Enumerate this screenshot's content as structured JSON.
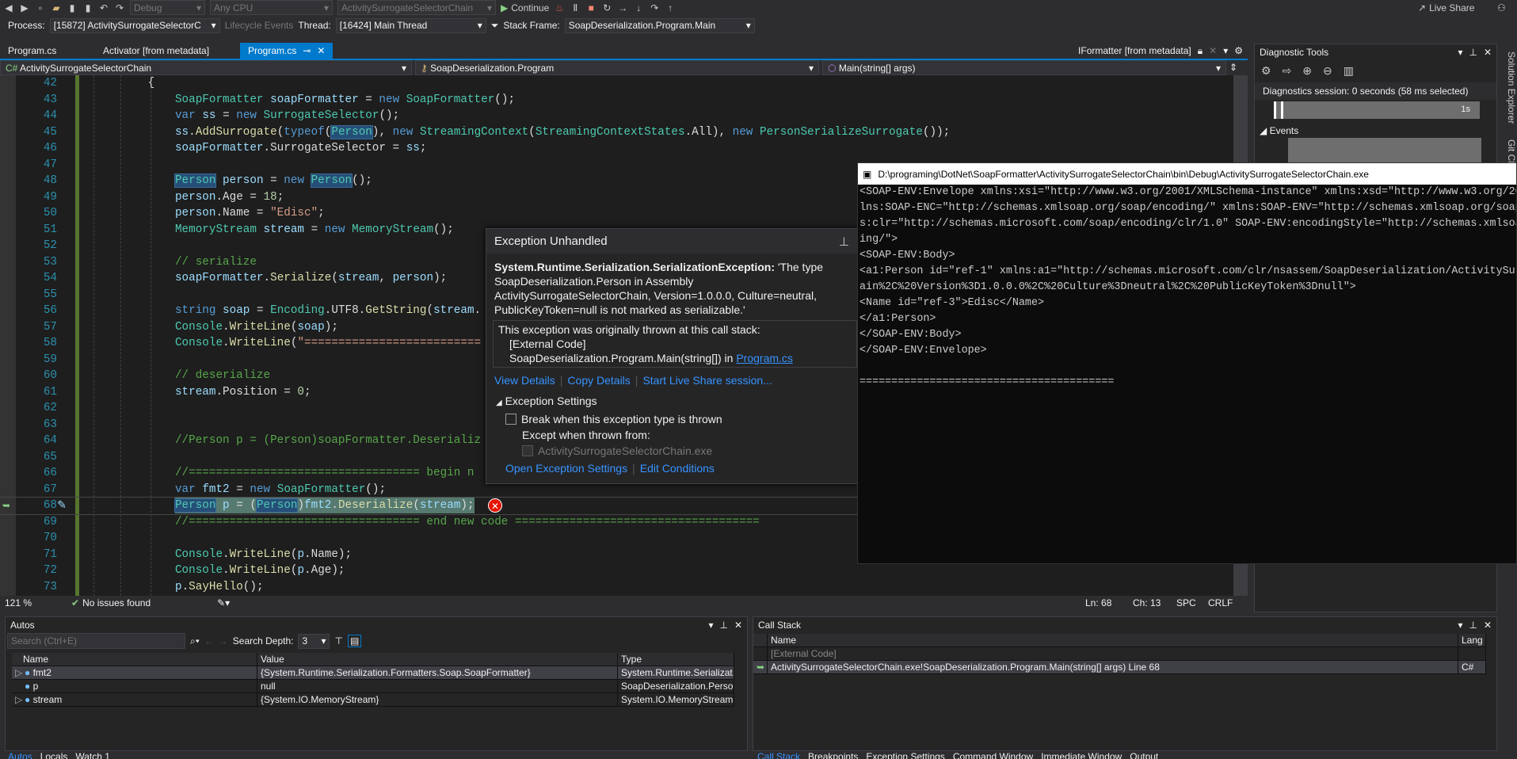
{
  "toolbar": {
    "config": "Debug",
    "platform": "Any CPU",
    "startup": "ActivitySurrogateSelectorChain",
    "continue": "Continue",
    "live_share": "Live Share"
  },
  "debug_location": {
    "process_label": "Process:",
    "process": "[15872] ActivitySurrogateSelectorC",
    "lifecycle": "Lifecycle Events",
    "thread_label": "Thread:",
    "thread": "[16424] Main Thread",
    "frame_label": "Stack Frame:",
    "frame": "SoapDeserialization.Program.Main"
  },
  "tabs": [
    {
      "label": "Program.cs"
    },
    {
      "label": "Activator [from metadata]"
    },
    {
      "label": "Program.cs",
      "active": true
    }
  ],
  "right_tab": "IFormatter [from metadata]",
  "navbar": {
    "project": "ActivitySurrogateSelectorChain",
    "type": "SoapDeserialization.Program",
    "member": "Main(string[] args)"
  },
  "code": {
    "first_line": 42,
    "current_line": 68,
    "lines": [
      [
        [
          "p",
          "        {"
        ]
      ],
      [
        [
          "p",
          "            "
        ],
        [
          "t",
          "SoapFormatter"
        ],
        [
          "p",
          " "
        ],
        [
          "v",
          "soapFormatter"
        ],
        [
          "p",
          " = "
        ],
        [
          "k",
          "new"
        ],
        [
          "p",
          " "
        ],
        [
          "t",
          "SoapFormatter"
        ],
        [
          "p",
          "();"
        ]
      ],
      [
        [
          "p",
          "            "
        ],
        [
          "k",
          "var"
        ],
        [
          "p",
          " "
        ],
        [
          "v",
          "ss"
        ],
        [
          "p",
          " = "
        ],
        [
          "k",
          "new"
        ],
        [
          "p",
          " "
        ],
        [
          "t",
          "SurrogateSelector"
        ],
        [
          "p",
          "();"
        ]
      ],
      [
        [
          "p",
          "            "
        ],
        [
          "v",
          "ss"
        ],
        [
          "p",
          "."
        ],
        [
          "m",
          "AddSurrogate"
        ],
        [
          "p",
          "("
        ],
        [
          "k",
          "typeof"
        ],
        [
          "p",
          "("
        ],
        [
          "th",
          "Person"
        ],
        [
          "p",
          "), "
        ],
        [
          "k",
          "new"
        ],
        [
          "p",
          " "
        ],
        [
          "t",
          "StreamingContext"
        ],
        [
          "p",
          "("
        ],
        [
          "t",
          "StreamingContextStates"
        ],
        [
          "p",
          ".All), "
        ],
        [
          "k",
          "new"
        ],
        [
          "p",
          " "
        ],
        [
          "t",
          "PersonSerializeSurrogate"
        ],
        [
          "p",
          "());"
        ]
      ],
      [
        [
          "p",
          "            "
        ],
        [
          "v",
          "soapFormatter"
        ],
        [
          "p",
          ".SurrogateSelector = "
        ],
        [
          "v",
          "ss"
        ],
        [
          "p",
          ";"
        ]
      ],
      [],
      [
        [
          "p",
          "            "
        ],
        [
          "th",
          "Person"
        ],
        [
          "p",
          " "
        ],
        [
          "v",
          "person"
        ],
        [
          "p",
          " = "
        ],
        [
          "k",
          "new"
        ],
        [
          "p",
          " "
        ],
        [
          "th",
          "Person"
        ],
        [
          "p",
          "();"
        ]
      ],
      [
        [
          "p",
          "            "
        ],
        [
          "v",
          "person"
        ],
        [
          "p",
          ".Age = "
        ],
        [
          "n",
          "18"
        ],
        [
          "p",
          ";"
        ]
      ],
      [
        [
          "p",
          "            "
        ],
        [
          "v",
          "person"
        ],
        [
          "p",
          ".Name = "
        ],
        [
          "s",
          "\"Edisc\""
        ],
        [
          "p",
          ";"
        ]
      ],
      [
        [
          "p",
          "            "
        ],
        [
          "t",
          "MemoryStream"
        ],
        [
          "p",
          " "
        ],
        [
          "v",
          "stream"
        ],
        [
          "p",
          " = "
        ],
        [
          "k",
          "new"
        ],
        [
          "p",
          " "
        ],
        [
          "t",
          "MemoryStream"
        ],
        [
          "p",
          "();"
        ]
      ],
      [],
      [
        [
          "p",
          "            "
        ],
        [
          "c",
          "// serialize"
        ]
      ],
      [
        [
          "p",
          "            "
        ],
        [
          "v",
          "soapFormatter"
        ],
        [
          "p",
          "."
        ],
        [
          "m",
          "Serialize"
        ],
        [
          "p",
          "("
        ],
        [
          "v",
          "stream"
        ],
        [
          "p",
          ", "
        ],
        [
          "v",
          "person"
        ],
        [
          "p",
          ");"
        ]
      ],
      [],
      [
        [
          "p",
          "            "
        ],
        [
          "k",
          "string"
        ],
        [
          "p",
          " "
        ],
        [
          "v",
          "soap"
        ],
        [
          "p",
          " = "
        ],
        [
          "t",
          "Encoding"
        ],
        [
          "p",
          ".UTF8."
        ],
        [
          "m",
          "GetString"
        ],
        [
          "p",
          "("
        ],
        [
          "v",
          "stream"
        ],
        [
          "p",
          "."
        ]
      ],
      [
        [
          "p",
          "            "
        ],
        [
          "t",
          "Console"
        ],
        [
          "p",
          "."
        ],
        [
          "m",
          "WriteLine"
        ],
        [
          "p",
          "("
        ],
        [
          "v",
          "soap"
        ],
        [
          "p",
          ");"
        ]
      ],
      [
        [
          "p",
          "            "
        ],
        [
          "t",
          "Console"
        ],
        [
          "p",
          "."
        ],
        [
          "m",
          "WriteLine"
        ],
        [
          "p",
          "("
        ],
        [
          "s",
          "\"=========================="
        ]
      ],
      [],
      [
        [
          "p",
          "            "
        ],
        [
          "c",
          "// deserialize"
        ]
      ],
      [
        [
          "p",
          "            "
        ],
        [
          "v",
          "stream"
        ],
        [
          "p",
          ".Position = "
        ],
        [
          "n",
          "0"
        ],
        [
          "p",
          ";"
        ]
      ],
      [],
      [],
      [
        [
          "p",
          "            "
        ],
        [
          "c",
          "//Person p = (Person)soapFormatter.Deserializ"
        ]
      ],
      [],
      [
        [
          "p",
          "            "
        ],
        [
          "c",
          "//================================== begin n"
        ]
      ],
      [
        [
          "p",
          "            "
        ],
        [
          "k",
          "var"
        ],
        [
          "p",
          " "
        ],
        [
          "v",
          "fmt2"
        ],
        [
          "p",
          " = "
        ],
        [
          "k",
          "new"
        ],
        [
          "p",
          " "
        ],
        [
          "t",
          "SoapFormatter"
        ],
        [
          "p",
          "();"
        ]
      ],
      [
        [
          "p",
          "            "
        ],
        [
          "th",
          "Person"
        ],
        [
          "p",
          " "
        ],
        [
          "v",
          "p"
        ],
        [
          "p",
          " = ("
        ],
        [
          "th",
          "Person"
        ],
        [
          "p",
          ")"
        ],
        [
          "v",
          "fmt2"
        ],
        [
          "p",
          "."
        ],
        [
          "m",
          "Deserialize"
        ],
        [
          "p",
          "("
        ],
        [
          "v",
          "stream"
        ],
        [
          "p",
          ");"
        ]
      ],
      [
        [
          "p",
          "            "
        ],
        [
          "c",
          "//================================== end new code ===================================="
        ]
      ],
      [],
      [
        [
          "p",
          "            "
        ],
        [
          "t",
          "Console"
        ],
        [
          "p",
          "."
        ],
        [
          "m",
          "WriteLine"
        ],
        [
          "p",
          "("
        ],
        [
          "v",
          "p"
        ],
        [
          "p",
          ".Name);"
        ]
      ],
      [
        [
          "p",
          "            "
        ],
        [
          "t",
          "Console"
        ],
        [
          "p",
          "."
        ],
        [
          "m",
          "WriteLine"
        ],
        [
          "p",
          "("
        ],
        [
          "v",
          "p"
        ],
        [
          "p",
          ".Age);"
        ]
      ],
      [
        [
          "p",
          "            "
        ],
        [
          "v",
          "p"
        ],
        [
          "p",
          "."
        ],
        [
          "m",
          "SayHello"
        ],
        [
          "p",
          "();"
        ]
      ]
    ]
  },
  "editor_status": {
    "zoom": "121 %",
    "issues": "No issues found",
    "ln": "Ln: 68",
    "ch": "Ch: 13",
    "spc": "SPC",
    "crlf": "CRLF"
  },
  "exception": {
    "title": "Exception Unhandled",
    "type": "System.Runtime.Serialization.SerializationException:",
    "message": " 'The type SoapDeserialization.Person in Assembly ActivitySurrogateSelectorChain, Version=1.0.0.0, Culture=neutral, PublicKeyToken=null is not marked as serializable.'",
    "stack_intro": "This exception was originally thrown at this call stack:",
    "stack": [
      "[External Code]",
      "SoapDeserialization.Program.Main(string[]) in "
    ],
    "stack_link": "Program.cs",
    "links": [
      "View Details",
      "Copy Details",
      "Start Live Share session..."
    ],
    "settings_label": "Exception Settings",
    "break_label": "Break when this exception type is thrown",
    "except_label": "Except when thrown from:",
    "except_item": "ActivitySurrogateSelectorChain.exe",
    "bottom_links": [
      "Open Exception Settings",
      "Edit Conditions"
    ]
  },
  "console": {
    "title": "D:\\programing\\DotNet\\SoapFormatter\\ActivitySurrogateSelectorChain\\bin\\Debug\\ActivitySurrogateSelectorChain.exe",
    "lines": [
      "<SOAP-ENV:Envelope xmlns:xsi=\"http://www.w3.org/2001/XMLSchema-instance\" xmlns:xsd=\"http://www.w3.org/20",
      "lns:SOAP-ENC=\"http://schemas.xmlsoap.org/soap/encoding/\" xmlns:SOAP-ENV=\"http://schemas.xmlsoap.org/soap",
      "s:clr=\"http://schemas.microsoft.com/soap/encoding/clr/1.0\" SOAP-ENV:encodingStyle=\"http://schemas.xmlsoa",
      "ing/\">",
      "<SOAP-ENV:Body>",
      "<a1:Person id=\"ref-1\" xmlns:a1=\"http://schemas.microsoft.com/clr/nsassem/SoapDeserialization/ActivitySur",
      "ain%2C%20Version%3D1.0.0.0%2C%20Culture%3Dneutral%2C%20PublicKeyToken%3Dnull\">",
      "<Name id=\"ref-3\">Edisc</Name>",
      "</a1:Person>",
      "</SOAP-ENV:Body>",
      "</SOAP-ENV:Envelope>",
      "",
      "========================================"
    ]
  },
  "diagnostics": {
    "title": "Diagnostic Tools",
    "session": "Diagnostics session: 0 seconds (58 ms selected)",
    "tick": "1s",
    "events": "Events"
  },
  "side_tabs": [
    "Solution Explorer",
    "Git Changes"
  ],
  "autos": {
    "title": "Autos",
    "search_placeholder": "Search (Ctrl+E)",
    "depth_label": "Search Depth:",
    "depth": "3",
    "columns": [
      "Name",
      "Value",
      "Type"
    ],
    "rows": [
      {
        "name": "fmt2",
        "value": "{System.Runtime.Serialization.Formatters.Soap.SoapFormatter}",
        "type": "System.Runtime.Serializat...",
        "expandable": true
      },
      {
        "name": "p",
        "value": "null",
        "type": "SoapDeserialization.Person",
        "expandable": false
      },
      {
        "name": "stream",
        "value": "{System.IO.MemoryStream}",
        "type": "System.IO.MemoryStream",
        "expandable": true
      }
    ],
    "tabs": [
      "Autos",
      "Locals",
      "Watch 1"
    ]
  },
  "callstack": {
    "title": "Call Stack",
    "columns": [
      "Name",
      "Lang"
    ],
    "rows": [
      {
        "name": "[External Code]",
        "lang": ""
      },
      {
        "name": "ActivitySurrogateSelectorChain.exe!SoapDeserialization.Program.Main(string[] args) Line 68",
        "lang": "C#"
      }
    ],
    "tabs": [
      "Call Stack",
      "Breakpoints",
      "Exception Settings",
      "Command Window",
      "Immediate Window",
      "Output"
    ]
  },
  "colors": {
    "accent": "#007acc",
    "error": "#e51400",
    "link": "#3794ff"
  }
}
